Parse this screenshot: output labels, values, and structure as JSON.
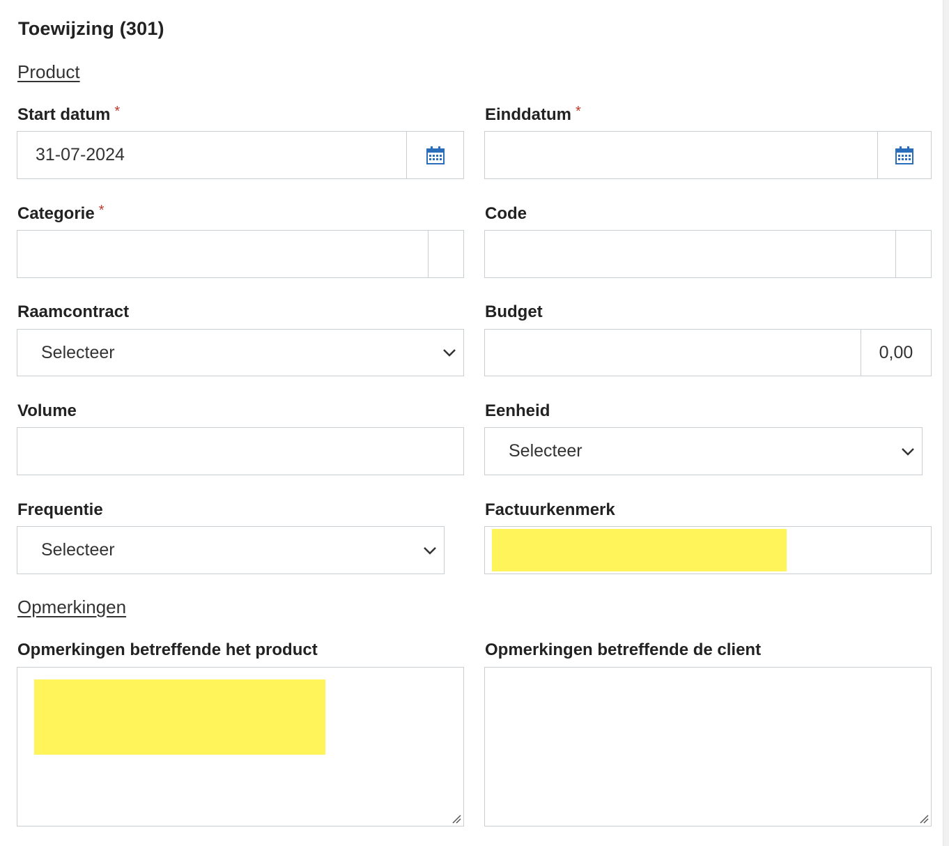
{
  "form": {
    "title": "Toewijzing (301)",
    "section_product": "Product",
    "section_remarks": "Opmerkingen",
    "required_marker": "*",
    "fields": {
      "start_date": {
        "label": "Start datum",
        "value": "31-07-2024",
        "icon": "calendar-icon"
      },
      "end_date": {
        "label": "Einddatum",
        "value": "",
        "icon": "calendar-icon"
      },
      "category": {
        "label": "Categorie",
        "value": ""
      },
      "code": {
        "label": "Code",
        "value": ""
      },
      "framework_contract": {
        "label": "Raamcontract",
        "selected": "Selecteer",
        "icon": "chevron-down-icon"
      },
      "budget": {
        "label": "Budget",
        "value": "",
        "addon": "0,00"
      },
      "volume": {
        "label": "Volume",
        "value": ""
      },
      "unit": {
        "label": "Eenheid",
        "selected": "Selecteer",
        "icon": "chevron-down-icon"
      },
      "frequency": {
        "label": "Frequentie",
        "selected": "Selecteer",
        "icon": "chevron-down-icon"
      },
      "invoice_reference": {
        "label": "Factuurkenmerk",
        "value": ""
      },
      "remarks_product": {
        "label": "Opmerkingen betreffende het product",
        "value": ""
      },
      "remarks_client": {
        "label": "Opmerkingen betreffende de client",
        "value": ""
      }
    }
  },
  "colors": {
    "required": "#c0392b",
    "calendar_icon": "#2a6ebb",
    "redaction": "#fff45a",
    "border": "#c9ced3"
  }
}
